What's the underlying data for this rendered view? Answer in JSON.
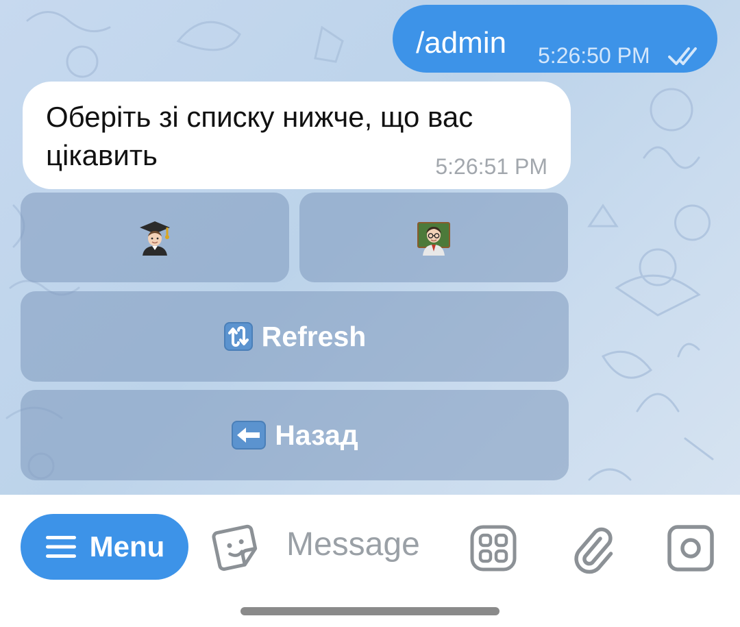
{
  "messages": {
    "outgoing": {
      "text": "/admin",
      "time": "5:26:50 PM",
      "status_icon": "double-check-icon"
    },
    "incoming": {
      "text": "Оберіть зі списку нижче, що вас цікавить",
      "time": "5:26:51 PM"
    }
  },
  "keyboard": {
    "row1": [
      {
        "icon": "student-emoji-icon",
        "label": ""
      },
      {
        "icon": "teacher-emoji-icon",
        "label": ""
      }
    ],
    "refresh": {
      "icon": "refresh-arrows-icon",
      "label": "Refresh"
    },
    "back": {
      "icon": "left-arrow-icon",
      "label": "Назад"
    }
  },
  "input_bar": {
    "menu_label": "Menu",
    "placeholder": "Message",
    "icons": [
      "hamburger-icon",
      "sticker-icon",
      "apps-grid-icon",
      "paperclip-icon",
      "camera-icon"
    ]
  },
  "colors": {
    "accent": "#3d93e8",
    "chat_background": "#c7d9ef",
    "keyboard_button": "#8ea7c7"
  }
}
